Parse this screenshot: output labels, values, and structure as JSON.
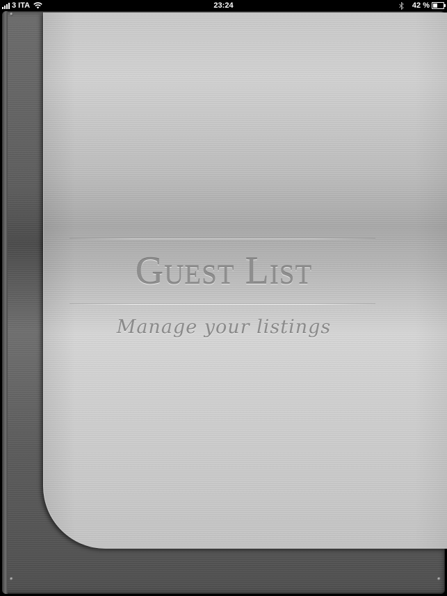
{
  "status_bar": {
    "carrier": "3 ITA",
    "time": "23:24",
    "battery_percent": "42 %",
    "battery_level": 0.42,
    "icons": {
      "signal": "signal-bars-icon",
      "wifi": "wifi-icon",
      "bluetooth": "bluetooth-icon",
      "battery": "battery-icon"
    }
  },
  "splash": {
    "title": "Guest List",
    "subtitle": "Manage your listings"
  },
  "colors": {
    "metal_light": "#d2d2d2",
    "metal_dark": "#5c5c5c",
    "text_engraved": "#8e8e8e"
  }
}
